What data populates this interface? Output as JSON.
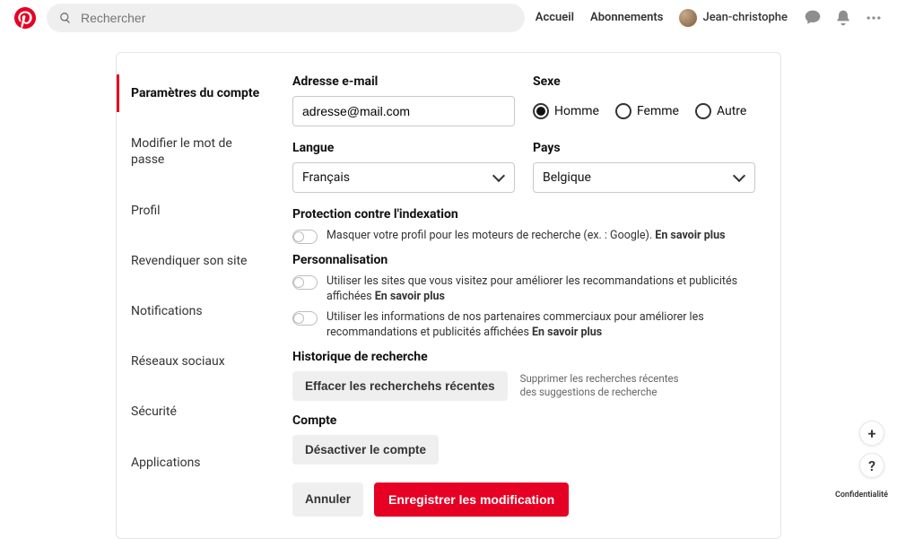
{
  "header": {
    "search_placeholder": "Rechercher",
    "nav_home": "Accueil",
    "nav_subs": "Abonnements",
    "user_name": "Jean-christophe"
  },
  "sidebar": {
    "items": [
      "Paramètres du compte",
      "Modifier le mot de passe",
      "Profil",
      "Revendiquer son site",
      "Notifications",
      "Réseaux sociaux",
      "Sécurité",
      "Applications"
    ]
  },
  "form": {
    "email_label": "Adresse e-mail",
    "email_value": "adresse@mail.com",
    "gender_label": "Sexe",
    "gender_options": {
      "male": "Homme",
      "female": "Femme",
      "other": "Autre"
    },
    "language_label": "Langue",
    "language_value": "Français",
    "country_label": "Pays",
    "country_value": "Belgique",
    "indexing_title": "Protection contre l'indexation",
    "indexing_text": "Masquer votre profil pour les moteurs de recherche (ex. : Google). ",
    "learn_more": "En savoir plus",
    "personalization_title": "Personnalisation",
    "pers1": "Utiliser les sites que vous visitez pour améliorer les recommandations et publicités affichées ",
    "pers2": "Utiliser les informations de nos partenaires commerciaux pour améliorer les recommandations et publicités affichées ",
    "history_title": "Historique de recherche",
    "history_button": "Effacer les recherchehs récentes",
    "history_desc": "Supprimer les recherches récentes des suggestions de recherche",
    "account_title": "Compte",
    "account_button": "Désactiver le compte",
    "cancel": "Annuler",
    "save": "Enregistrer les modification"
  },
  "float": {
    "plus": "+",
    "help": "?"
  },
  "privacy_label": "Confidentialité"
}
